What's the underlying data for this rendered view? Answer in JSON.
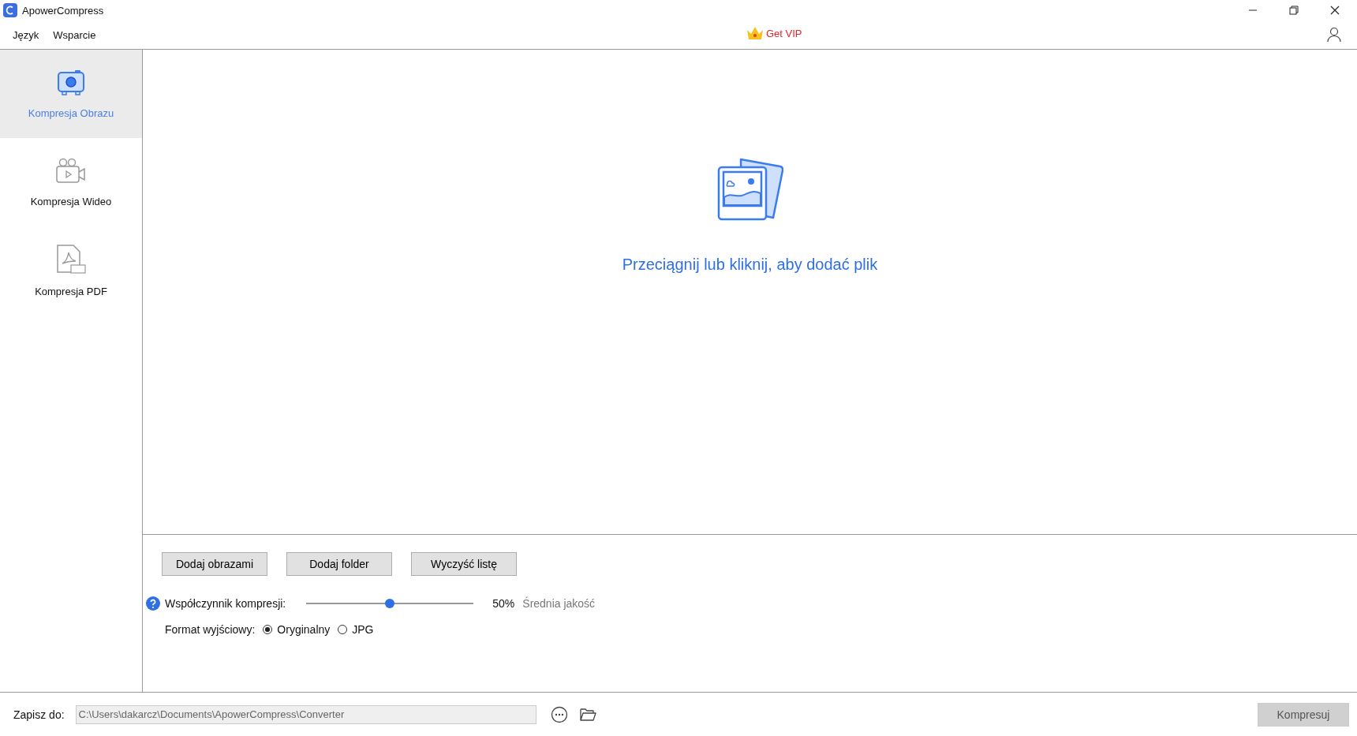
{
  "window": {
    "title": "ApowerCompress"
  },
  "menu": [
    "Język",
    "Wsparcie"
  ],
  "vip": {
    "label": "Get VIP"
  },
  "sidebar": {
    "items": [
      {
        "kind": "image",
        "label": "Kompresja Obrazu",
        "selected": true
      },
      {
        "kind": "video",
        "label": "Kompresja Wideo",
        "selected": false
      },
      {
        "kind": "pdf",
        "label": "Kompresja PDF",
        "selected": false
      }
    ]
  },
  "drop_zone": {
    "text": "Przeciągnij lub kliknij, aby dodać plik"
  },
  "buttons": [
    "Dodaj obrazami",
    "Dodaj folder",
    "Wyczyść listę"
  ],
  "compression": {
    "label": "Współczynnik kompresji:",
    "level": 0.5,
    "reading": "50%",
    "quality": "Średnia jakość"
  },
  "format": {
    "label": "Format wyjściowy:",
    "options": [
      {
        "label": "Oryginalny",
        "selected": true
      },
      {
        "label": "JPG",
        "selected": false
      }
    ]
  },
  "save": {
    "label": "Zapisz do:",
    "value": "C:\\Users\\dakarcz\\Documents\\ApowerCompress\\Converter"
  },
  "compress_button": {
    "label": "Kompresuj",
    "disabled": true
  }
}
